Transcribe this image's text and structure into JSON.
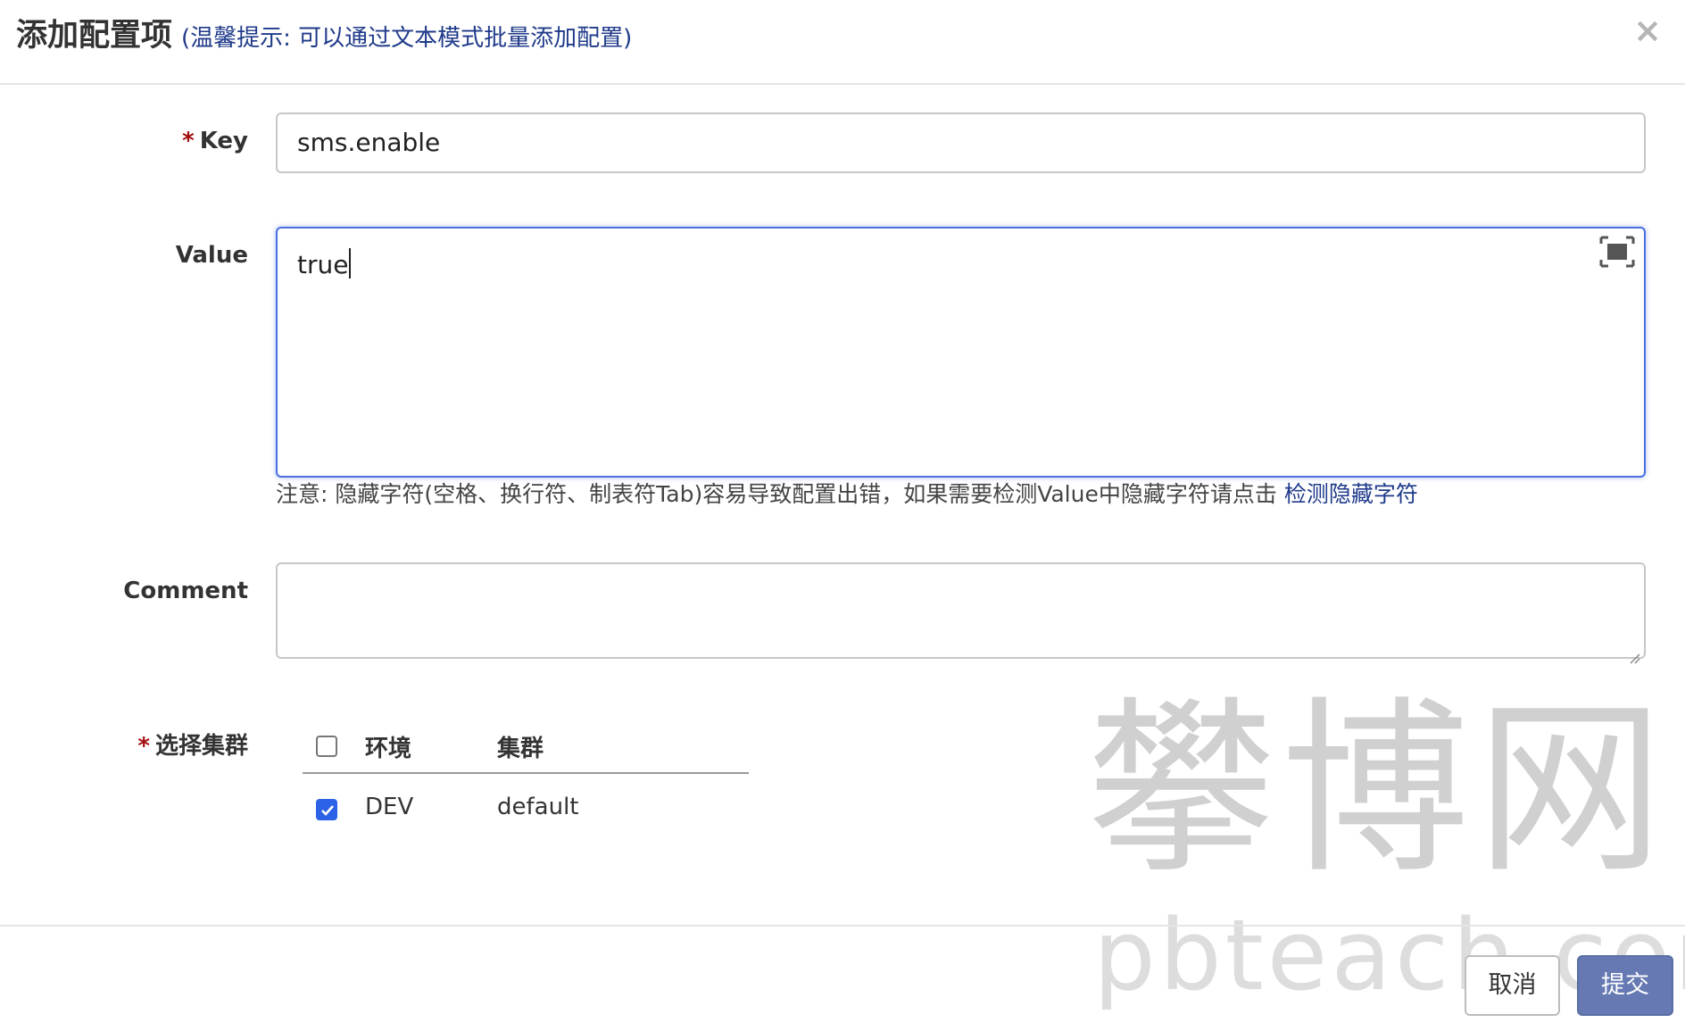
{
  "header": {
    "title": "添加配置项",
    "tip": "(温馨提示: 可以通过文本模式批量添加配置)",
    "close_label": "×"
  },
  "form": {
    "key": {
      "label": "Key",
      "required_mark": "*",
      "value": "sms.enable"
    },
    "value": {
      "label": "Value",
      "text": "true",
      "fullscreen_icon": "fullscreen-icon",
      "note": "注意: 隐藏字符(空格、换行符、制表符Tab)容易导致配置出错，如果需要检测Value中隐藏字符请点击",
      "note_link": "检测隐藏字符"
    },
    "comment": {
      "label": "Comment",
      "value": ""
    },
    "cluster": {
      "label": "选择集群",
      "required_mark": "*",
      "headers": {
        "env": "环境",
        "cluster": "集群"
      },
      "select_all_checked": false,
      "rows": [
        {
          "env": "DEV",
          "cluster": "default",
          "checked": true
        }
      ]
    }
  },
  "footer": {
    "cancel_label": "取消",
    "submit_label": "提交"
  },
  "watermark": {
    "cn": "攀博网",
    "en": "pbteach.com"
  },
  "colors": {
    "primary_blue": "#2b62e6",
    "submit_bg": "#6679b2",
    "required_red": "#a20f0f",
    "link": "#1f3a8a"
  }
}
